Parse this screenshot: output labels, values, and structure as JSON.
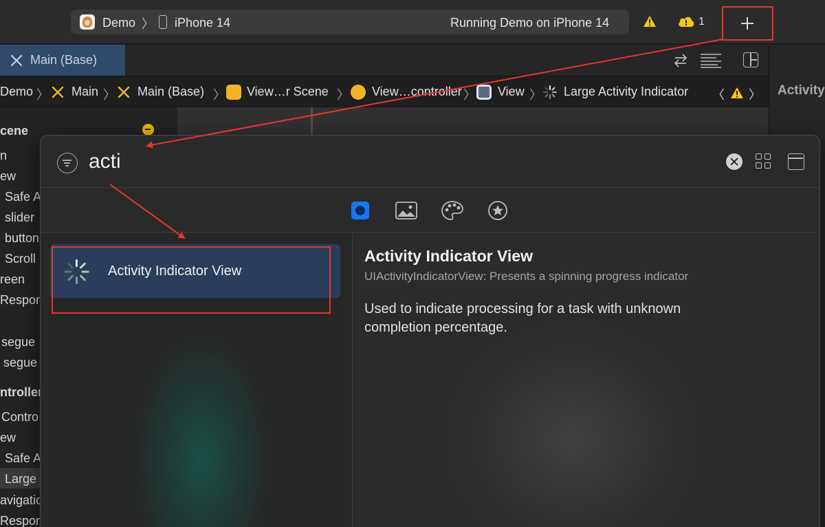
{
  "toolbar": {
    "scheme_name": "Demo",
    "device_name": "iPhone 14",
    "status_text": "Running Demo on iPhone 14",
    "issue_count": "1"
  },
  "tabs": {
    "active_tab": "Main (Base)"
  },
  "jumpbar": {
    "items": [
      "Demo",
      "Main",
      "Main (Base)",
      "View…r Scene",
      "View…controller",
      "View",
      "Large Activity Indicator"
    ]
  },
  "inspector": {
    "title": "Activity"
  },
  "outline": {
    "rows": [
      "cene",
      "n",
      "ew",
      "Safe A",
      "slider",
      "button",
      "Scroll",
      "reen",
      "Respon",
      "segue",
      "segue",
      "ntroller",
      "Contro",
      "ew",
      "Safe A",
      "Large",
      "avigatio",
      "Respon"
    ]
  },
  "library": {
    "search_value": "acti",
    "results": [
      {
        "label": "Activity Indicator View"
      }
    ],
    "detail": {
      "title": "Activity Indicator View",
      "subtitle": "UIActivityIndicatorView: Presents a spinning progress indicator",
      "description": "Used to indicate processing for a task with unknown completion percentage."
    }
  },
  "colors": {
    "annotation_red": "#e8372c",
    "selection_blue": "#2a3d5c",
    "accent_blue": "#1876f2",
    "warning_yellow": "#f5c518"
  }
}
